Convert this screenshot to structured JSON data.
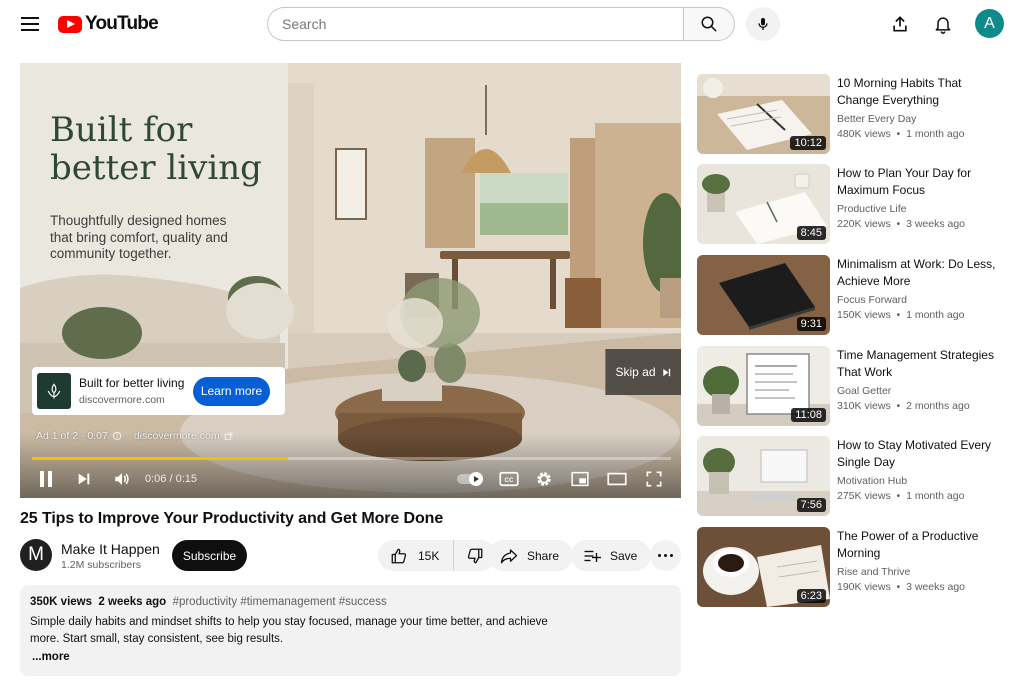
{
  "header": {
    "logo_text": "YouTube",
    "search_placeholder": "Search"
  },
  "player": {
    "ad_headline": "Built for better living",
    "ad_subtext": "Thoughtfully designed homes that bring comfort, quality and community together.",
    "ad_card_title": "Built for better living",
    "ad_card_domain": "discovermore.com",
    "learn_more_label": "Learn more",
    "skip_label": "Skip ad",
    "ad_counter": "Ad 1 of 2 · 0:07",
    "ad_info_domain": "discovermore.com",
    "time_display": "0:06 / 0:15",
    "ad_progress_fraction": 0.4,
    "progress_color": "#f2c200"
  },
  "video": {
    "title": "25 Tips to Improve Your Productivity and Get More Done",
    "channel_initial": "M",
    "channel_name": "Make It Happen",
    "subscribers": "1.2M subscribers",
    "subscribe_label": "Subscribe",
    "like_count": "15K",
    "share_label": "Share",
    "save_label": "Save"
  },
  "description": {
    "views": "350K views",
    "age": "2 weeks ago",
    "tags": "#productivity #timemanagement #success",
    "body": "Simple daily habits and mindset shifts to help you stay focused, manage your time better, and achieve more. Start small, stay consistent, see big results.",
    "more_label": "...more"
  },
  "sidebar": {
    "items": [
      {
        "title": "10 Morning Habits That Change Everything",
        "channel": "Better Every Day",
        "views": "480K views",
        "age": "1 month ago",
        "duration": "10:12"
      },
      {
        "title": "How to Plan Your Day for Maximum Focus",
        "channel": "Productive Life",
        "views": "220K views",
        "age": "3 weeks ago",
        "duration": "8:45"
      },
      {
        "title": "Minimalism at Work: Do Less, Achieve More",
        "channel": "Focus Forward",
        "views": "150K views",
        "age": "1 month ago",
        "duration": "9:31"
      },
      {
        "title": "Time Management Strategies That Work",
        "channel": "Goal Getter",
        "views": "310K views",
        "age": "2 months ago",
        "duration": "11:08"
      },
      {
        "title": "How to Stay Motivated Every Single Day",
        "channel": "Motivation Hub",
        "views": "275K views",
        "age": "1 month ago",
        "duration": "7:56"
      },
      {
        "title": "The Power of a Productive Morning",
        "channel": "Rise and Thrive",
        "views": "190K views",
        "age": "3 weeks ago",
        "duration": "6:23"
      }
    ]
  },
  "colors": {
    "brand_red": "#ff0000",
    "subscribe_bg": "#0f0f0f",
    "learn_more_bg": "#065fd4",
    "avatar_bg": "#0f8a8a",
    "ad_logo_bg": "#1d3b2f"
  },
  "icons": {
    "menu": "hamburger-menu-icon",
    "search": "search-icon",
    "mic": "microphone-icon",
    "create": "upload-icon",
    "notifications": "bell-icon",
    "play_pause": "pause-icon",
    "next": "skip-next-icon",
    "volume": "volume-icon",
    "autoplay": "autoplay-toggle-icon",
    "captions": "captions-icon",
    "settings": "gear-icon",
    "miniplayer": "miniplayer-icon",
    "theater": "theater-mode-icon",
    "fullscreen": "fullscreen-icon",
    "like": "thumbs-up-icon",
    "dislike": "thumbs-down-icon",
    "share": "share-arrow-icon",
    "save": "playlist-add-icon",
    "more": "more-dots-icon"
  }
}
